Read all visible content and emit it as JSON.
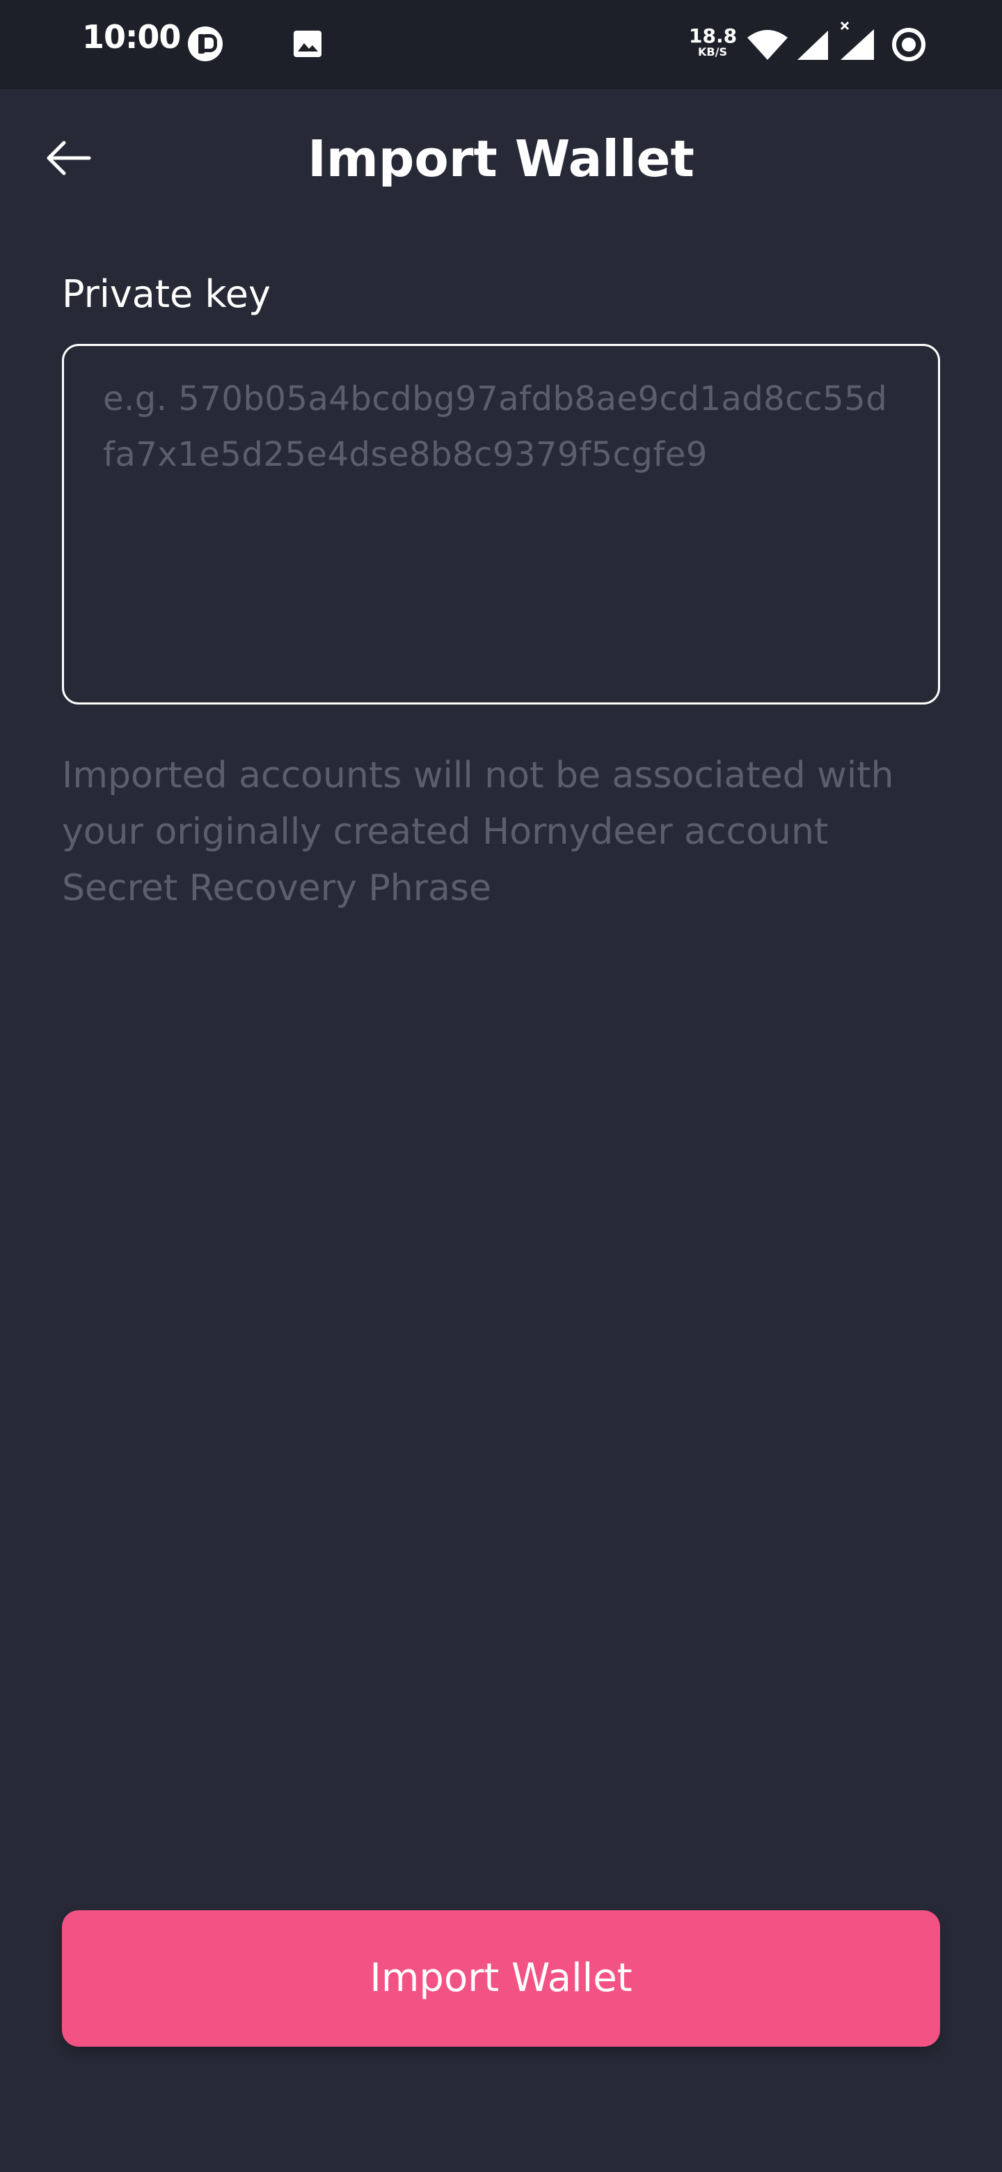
{
  "status_bar": {
    "time": "10:00",
    "net_speed_value": "18.8",
    "net_speed_unit": "KB/S",
    "icons": [
      "app-notification-icon",
      "gallery-icon",
      "wifi-icon",
      "cell-signal-icon",
      "cell-signal-no-data-icon",
      "focus-ring-icon"
    ]
  },
  "header": {
    "back_icon": "arrow-left-icon",
    "title": "Import Wallet"
  },
  "form": {
    "label": "Private key",
    "input_value": "",
    "input_placeholder": "e.g. 570b05a4bcdbg97afdb8ae9cd1ad8cc55dfa7x1e5d25e4dse8b8c9379f5cgfe9",
    "hint": "Imported accounts will not be associated with your originally created Hornydeer account Secret Recovery Phrase"
  },
  "footer": {
    "button_label": "Import Wallet"
  },
  "colors": {
    "background": "#272a36",
    "status_bar": "#1e2029",
    "accent": "#f35384",
    "muted_text": "#5b5e6c"
  }
}
